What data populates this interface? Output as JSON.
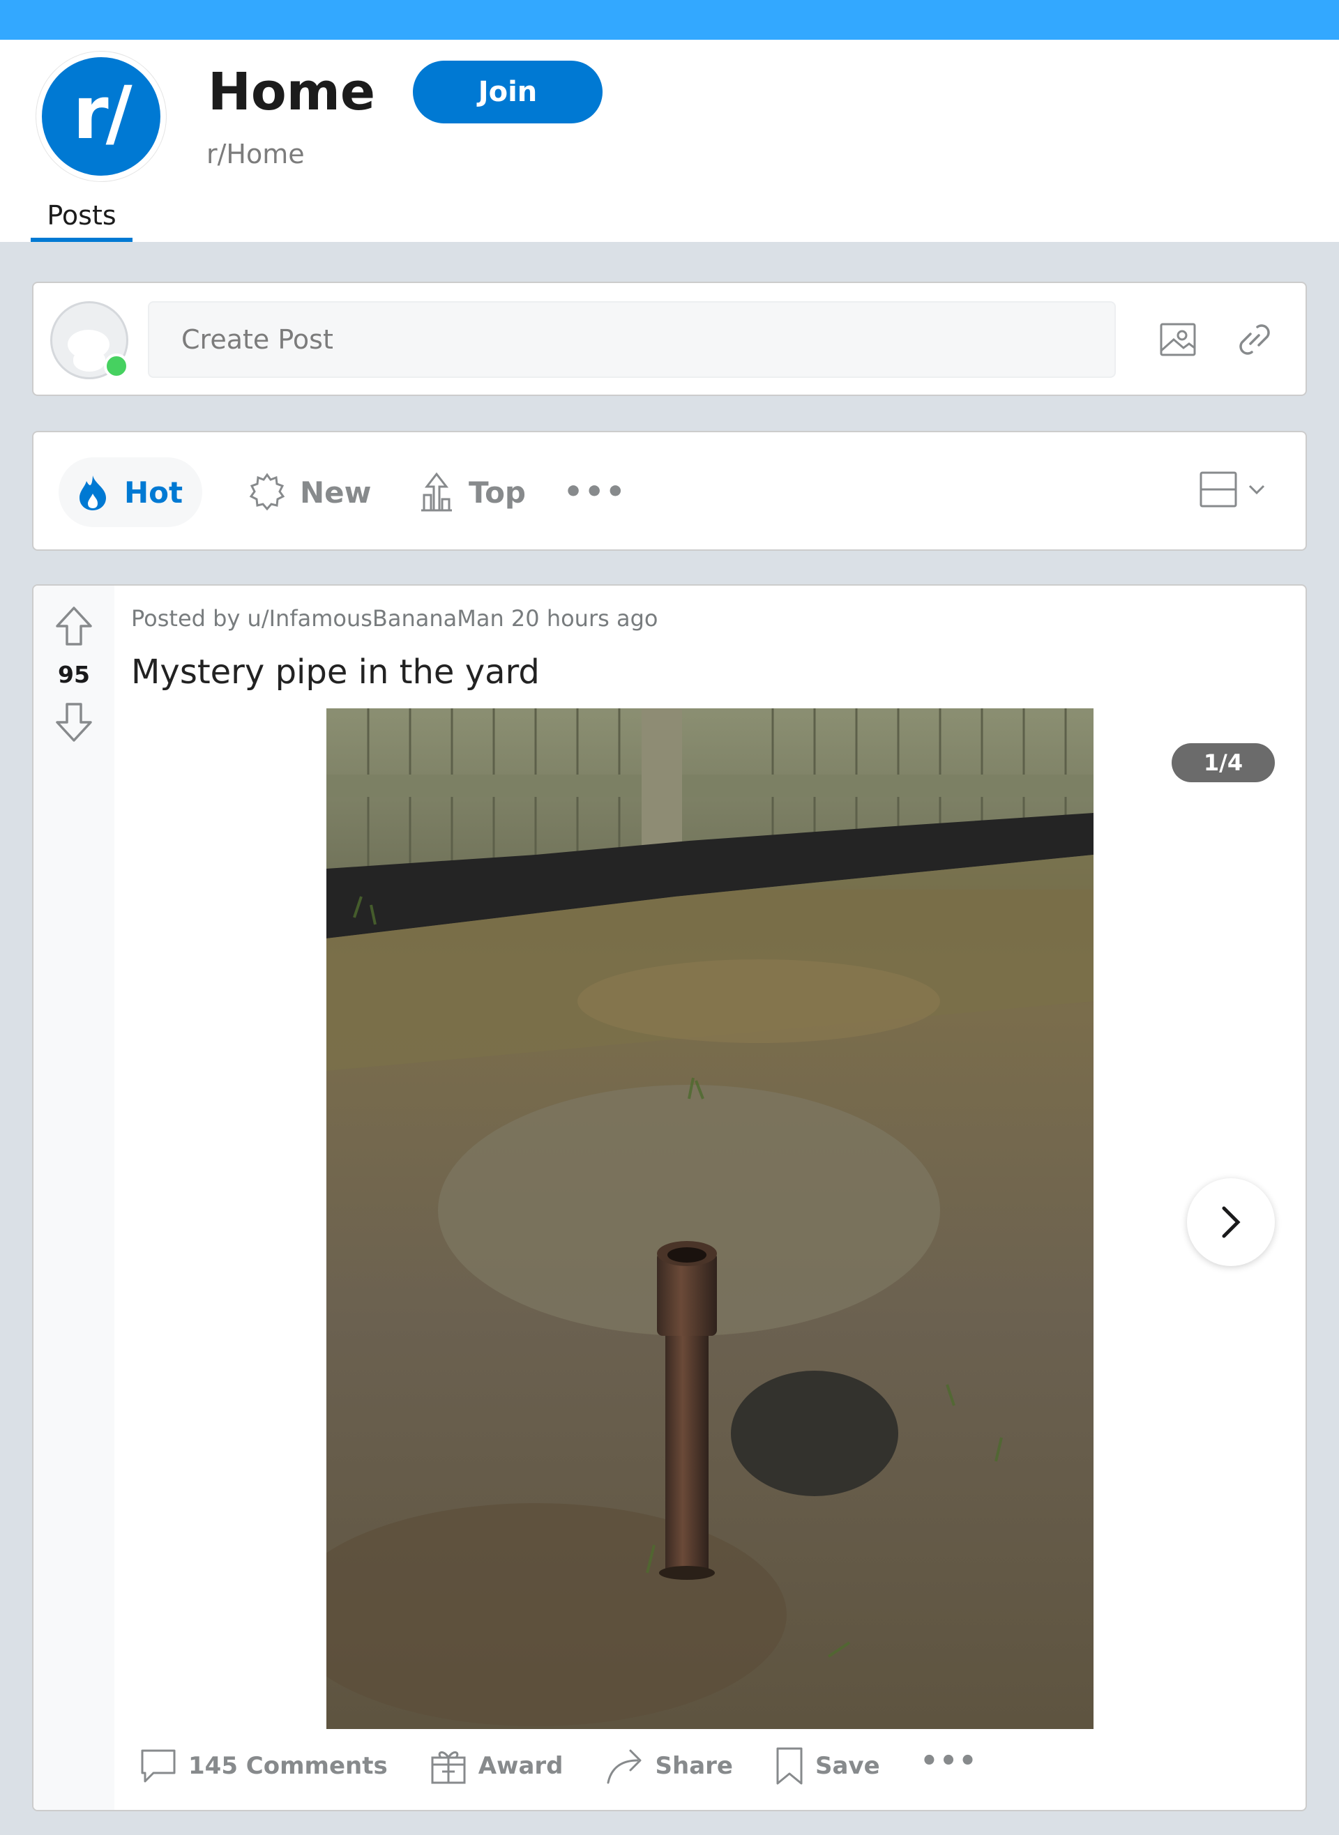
{
  "header": {
    "icon_text": "r/",
    "title": "Home",
    "join_label": "Join",
    "community_name": "r/Home",
    "tab_posts": "Posts"
  },
  "create_post": {
    "placeholder": "Create Post",
    "icons": [
      "image-icon",
      "link-icon"
    ]
  },
  "sort": {
    "hot": "Hot",
    "new": "New",
    "top": "Top",
    "more": "•••",
    "active": "hot"
  },
  "post": {
    "meta": "Posted by u/InfamousBananaMan 20 hours ago",
    "score": "95",
    "title": "Mystery pipe in the yard",
    "gallery_index": "1/4",
    "actions": {
      "comments": "145 Comments",
      "award": "Award",
      "share": "Share",
      "save": "Save",
      "more": "•••"
    }
  },
  "colors": {
    "top_bar": "#33a8ff",
    "brand_blue": "#0079d3",
    "page_bg": "#dae0e6",
    "online": "#46d160"
  }
}
